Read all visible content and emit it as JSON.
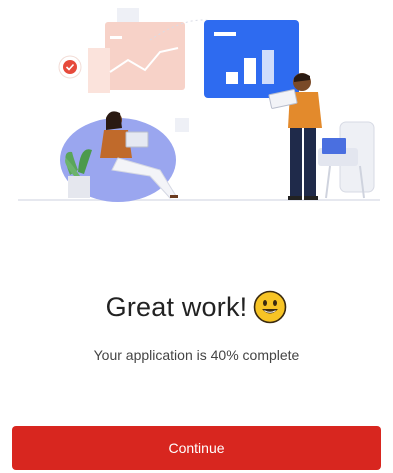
{
  "screen": {
    "headline": "Great work!",
    "headline_emoji": "grinning-face-emoji",
    "subtitle": "Your application is 40% complete",
    "progress_percent": 40,
    "continue_label": "Continue"
  },
  "illustration": {
    "name": "people-working-illustration"
  },
  "colors": {
    "primary_button": "#d8261f",
    "dashboard_card": "#2e6bf0",
    "chart_card": "#f5c8bd",
    "beanbag": "#9aa6ef",
    "emoji_face": "#f7c425"
  }
}
